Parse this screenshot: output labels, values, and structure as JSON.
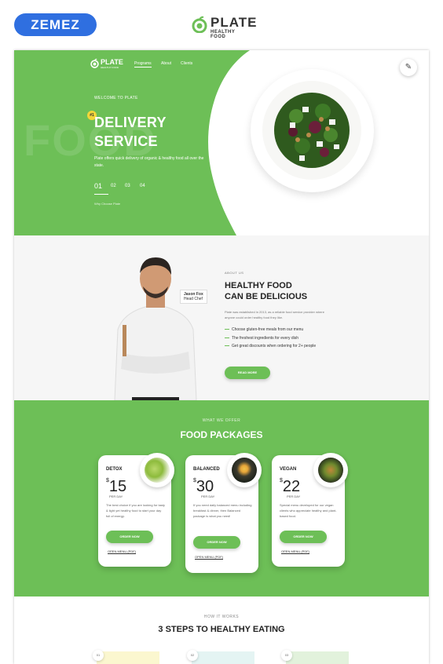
{
  "topbar": {
    "zemez_logo": "ZEMEZ",
    "brand": {
      "name": "PLATE",
      "tagline": "HEALTHY FOOD"
    }
  },
  "hero": {
    "nav_logo": {
      "name": "PLATE",
      "tagline": "HEALTHY FOOD"
    },
    "nav": [
      "Programs",
      "About",
      "Clients"
    ],
    "welcome": "WELCOME TO PLATE",
    "background_word": "FOOD",
    "badge": "#1",
    "title_line1": "DELIVERY",
    "title_line2": "SERVICE",
    "text": "Plate offers quick delivery of organic & healthy food all over the state.",
    "slides": [
      "01",
      "02",
      "03",
      "04"
    ],
    "why": "Why Choose Plate",
    "accent_color": "#6dbf57"
  },
  "about": {
    "chef_name": "Jason Fox",
    "chef_role": "Head Chef",
    "eyebrow": "ABOUT US",
    "title_line1": "HEALTHY FOOD",
    "title_line2": "CAN BE DELICIOUS",
    "text": "Plate was established in 2013, as a reliable food service provider where anyone could order healthy food they like.",
    "list": [
      "Choose gluten-free meals from our menu",
      "The freshest ingredients for every dish",
      "Get great discounts when ordering for 2+ people"
    ],
    "button": "READ MORE"
  },
  "packages": {
    "eyebrow": "WHAT WE OFFER",
    "title": "FOOD PACKAGES",
    "cards": [
      {
        "name": "DETOX",
        "currency": "$",
        "price": "15",
        "per": "PER DAY",
        "desc": "The best choice if you are looking for tasty & light yet healthy food to start your day full of energy.",
        "button": "ORDER NOW",
        "menu": "OPEN MENU (PDF)"
      },
      {
        "name": "BALANCED",
        "currency": "$",
        "price": "30",
        "per": "PER DAY",
        "desc": "If you need daily balanced menu including breakfast & dinner, then Balanced package is what you need!",
        "button": "ORDER NOW",
        "menu": "OPEN MENU (PDF)"
      },
      {
        "name": "VEGAN",
        "currency": "$",
        "price": "22",
        "per": "PER DAY",
        "desc": "Special menu developed for our vegan clients who appreciate healthy and plant-based food.",
        "button": "ORDER NOW",
        "menu": "OPEN MENU (PDF)"
      }
    ]
  },
  "steps": {
    "eyebrow": "HOW IT WORKS",
    "title": "3 STEPS TO HEALTHY EATING",
    "numbers": [
      "01",
      "02",
      "03"
    ]
  }
}
